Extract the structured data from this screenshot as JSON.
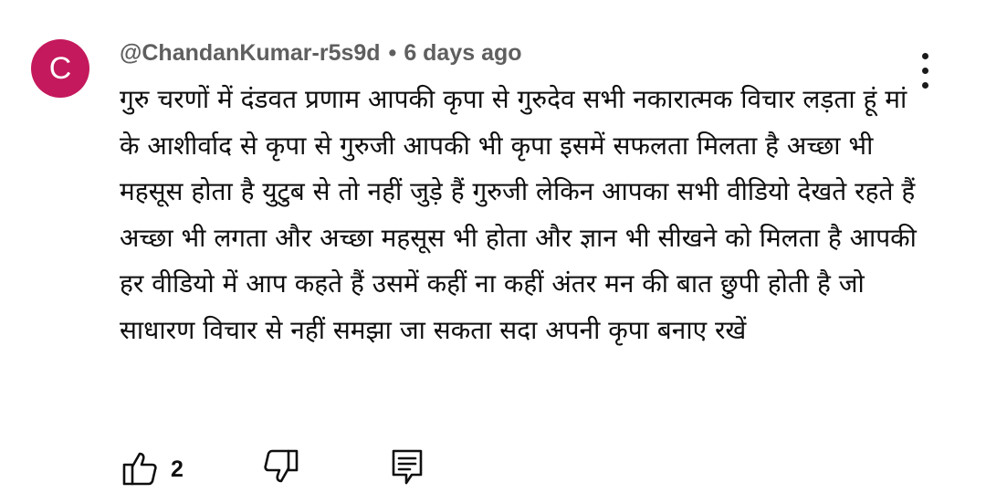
{
  "comment": {
    "avatar_letter": "C",
    "avatar_color": "#c4195c",
    "author": "@ChandanKumar-r5s9d",
    "separator": "•",
    "timestamp": "6 days ago",
    "text": "गुरु चरणों में दंडवत प्रणाम आपकी कृपा से गुरुदेव सभी नकारात्मक विचार लड़ता हूं मां के आशीर्वाद से कृपा से गुरुजी आपकी भी कृपा इसमें सफलता मिलता है अच्छा भी महसूस होता है युटुब से तो नहीं जुड़े हैं गुरुजी लेकिन आपका सभी वीडियो देखते रहते हैं अच्छा भी लगता और अच्छा महसूस भी होता और ज्ञान भी सीखने को मिलता है आपकी हर वीडियो में आप कहते हैं उसमें कहीं ना कहीं अंतर मन की बात छुपी होती है जो साधारण विचार से नहीं समझा जा सकता सदा अपनी कृपा बनाए रखें",
    "like_count": "2"
  },
  "icons": {
    "menu": "more-vertical-icon",
    "like": "thumbs-up-icon",
    "dislike": "thumbs-down-icon",
    "reply": "comment-reply-icon"
  }
}
